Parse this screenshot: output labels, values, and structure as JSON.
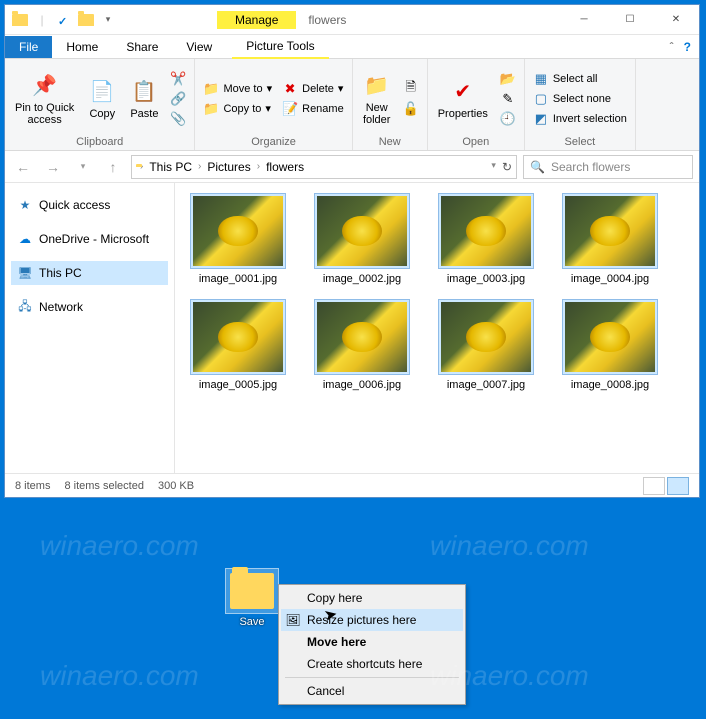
{
  "title": {
    "context_tab": "Manage",
    "tool_tab": "Picture Tools",
    "folder": "flowers"
  },
  "tabs": {
    "file": "File",
    "home": "Home",
    "share": "Share",
    "view": "View"
  },
  "ribbon": {
    "clipboard": {
      "pin": "Pin to Quick\naccess",
      "copy": "Copy",
      "paste": "Paste",
      "label": "Clipboard"
    },
    "organize": {
      "moveto": "Move to",
      "copyto": "Copy to",
      "delete": "Delete",
      "rename": "Rename",
      "label": "Organize"
    },
    "new": {
      "folder": "New\nfolder",
      "label": "New"
    },
    "open": {
      "properties": "Properties",
      "label": "Open"
    },
    "select": {
      "all": "Select all",
      "none": "Select none",
      "invert": "Invert selection",
      "label": "Select"
    }
  },
  "addr": {
    "thispc": "This PC",
    "pictures": "Pictures",
    "flowers": "flowers"
  },
  "search": {
    "placeholder": "Search flowers"
  },
  "nav": {
    "quick": "Quick access",
    "onedrive": "OneDrive - Microsoft",
    "thispc": "This PC",
    "network": "Network"
  },
  "files": [
    "image_0001.jpg",
    "image_0002.jpg",
    "image_0003.jpg",
    "image_0004.jpg",
    "image_0005.jpg",
    "image_0006.jpg",
    "image_0007.jpg",
    "image_0008.jpg"
  ],
  "status": {
    "count": "8 items",
    "selected": "8 items selected",
    "size": "300 KB"
  },
  "desktop": {
    "label": "Save"
  },
  "ctx": {
    "copy": "Copy here",
    "resize": "Resize pictures here",
    "move": "Move here",
    "shortcut": "Create shortcuts here",
    "cancel": "Cancel"
  },
  "watermark": "winaero.com"
}
